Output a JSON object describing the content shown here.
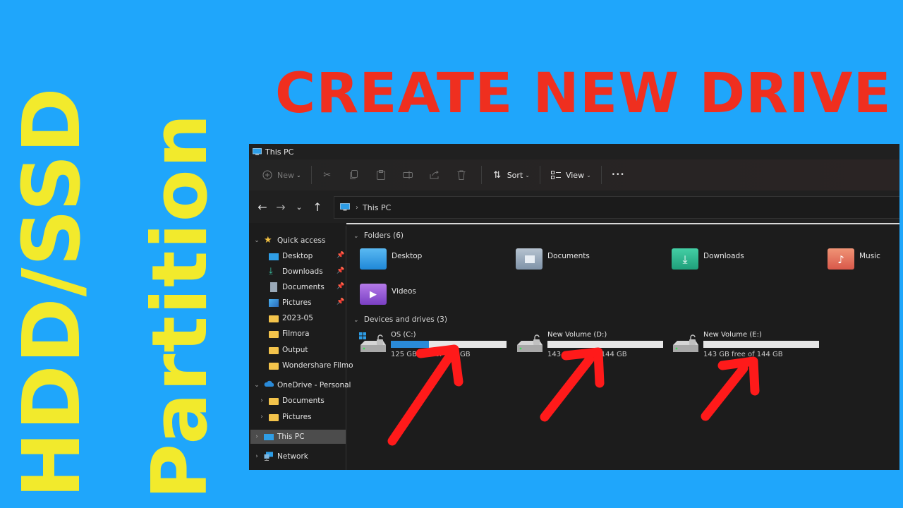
{
  "side_title_line1": "HDD/SSD",
  "side_title_line2": "Partition",
  "headline": "CREATE NEW DRIVE",
  "window": {
    "title": "This PC",
    "toolbar": {
      "new_label": "New",
      "sort_label": "Sort",
      "view_label": "View",
      "more_label": "•••"
    },
    "address": {
      "crumb": "This PC"
    },
    "nav": {
      "quick_access": "Quick access",
      "quick_items": [
        {
          "label": "Desktop"
        },
        {
          "label": "Downloads"
        },
        {
          "label": "Documents"
        },
        {
          "label": "Pictures"
        },
        {
          "label": "2023-05"
        },
        {
          "label": "Filmora"
        },
        {
          "label": "Output"
        },
        {
          "label": "Wondershare Filmo"
        }
      ],
      "onedrive": "OneDrive - Personal",
      "onedrive_items": [
        {
          "label": "Documents"
        },
        {
          "label": "Pictures"
        }
      ],
      "this_pc": "This PC",
      "network": "Network"
    },
    "folders_header": "Folders (6)",
    "folders": [
      {
        "label": "Desktop",
        "color": "#3aa7e8"
      },
      {
        "label": "Documents",
        "color": "#8fa3b8"
      },
      {
        "label": "Downloads",
        "color": "#2fb58c"
      },
      {
        "label": "Music",
        "color": "#e8715a"
      },
      {
        "label": "Videos",
        "color": "#9a5ad8"
      }
    ],
    "drives_header": "Devices and drives (3)",
    "drives": [
      {
        "name": "OS (C:)",
        "free_text": "125 GB free of 237 GB",
        "used_fraction": 0.33
      },
      {
        "name": "New Volume (D:)",
        "free_text": "143 GB free of 144 GB",
        "used_fraction": 0.0
      },
      {
        "name": "New Volume (E:)",
        "free_text": "143 GB free of 144 GB",
        "used_fraction": 0.0
      }
    ]
  },
  "colors": {
    "background": "#1fa6fb",
    "side_title": "#f2ea2c",
    "headline": "#ef2f1f",
    "arrow": "#ff1a1a",
    "drive_bar_fill": "#2a8ad8"
  }
}
